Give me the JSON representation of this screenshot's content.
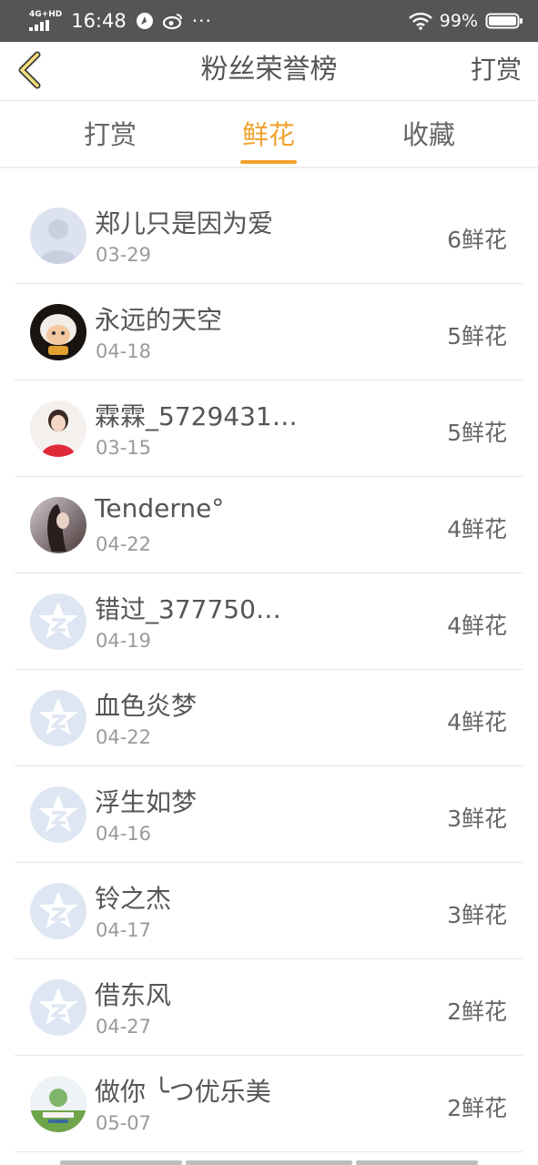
{
  "status_bar": {
    "network": "4G+HD",
    "time": "16:48",
    "extra": "···",
    "battery": "99%"
  },
  "header": {
    "title": "粉丝荣誉榜",
    "action": "打赏"
  },
  "tabs": [
    {
      "label": "打赏"
    },
    {
      "label": "鲜花"
    },
    {
      "label": "收藏"
    }
  ],
  "active_tab": 1,
  "list": [
    {
      "name": "郑儿只是因为爱",
      "date": "03-29",
      "count": "6鲜花",
      "avatar": "default-user"
    },
    {
      "name": "永远的天空",
      "date": "04-18",
      "count": "5鲜花",
      "avatar": "photo"
    },
    {
      "name": "霖霖_5729431…",
      "date": "03-15",
      "count": "5鲜花",
      "avatar": "photo"
    },
    {
      "name": "Tenderne°",
      "date": "04-22",
      "count": "4鲜花",
      "avatar": "photo"
    },
    {
      "name": "错过_377750…",
      "date": "04-19",
      "count": "4鲜花",
      "avatar": "qq-star"
    },
    {
      "name": "血色炎梦",
      "date": "04-22",
      "count": "4鲜花",
      "avatar": "qq-star"
    },
    {
      "name": "浮生如梦",
      "date": "04-16",
      "count": "3鲜花",
      "avatar": "qq-star"
    },
    {
      "name": "铃之杰",
      "date": "04-17",
      "count": "3鲜花",
      "avatar": "qq-star"
    },
    {
      "name": "借东风",
      "date": "04-27",
      "count": "2鲜花",
      "avatar": "qq-star"
    },
    {
      "name": "做你 ╰つ优乐美",
      "date": "05-07",
      "count": "2鲜花",
      "avatar": "photo"
    }
  ],
  "colors": {
    "accent": "#f0a22e",
    "status_bar_bg": "#555555",
    "text": "#555555",
    "subtext": "#9a9a9a"
  }
}
